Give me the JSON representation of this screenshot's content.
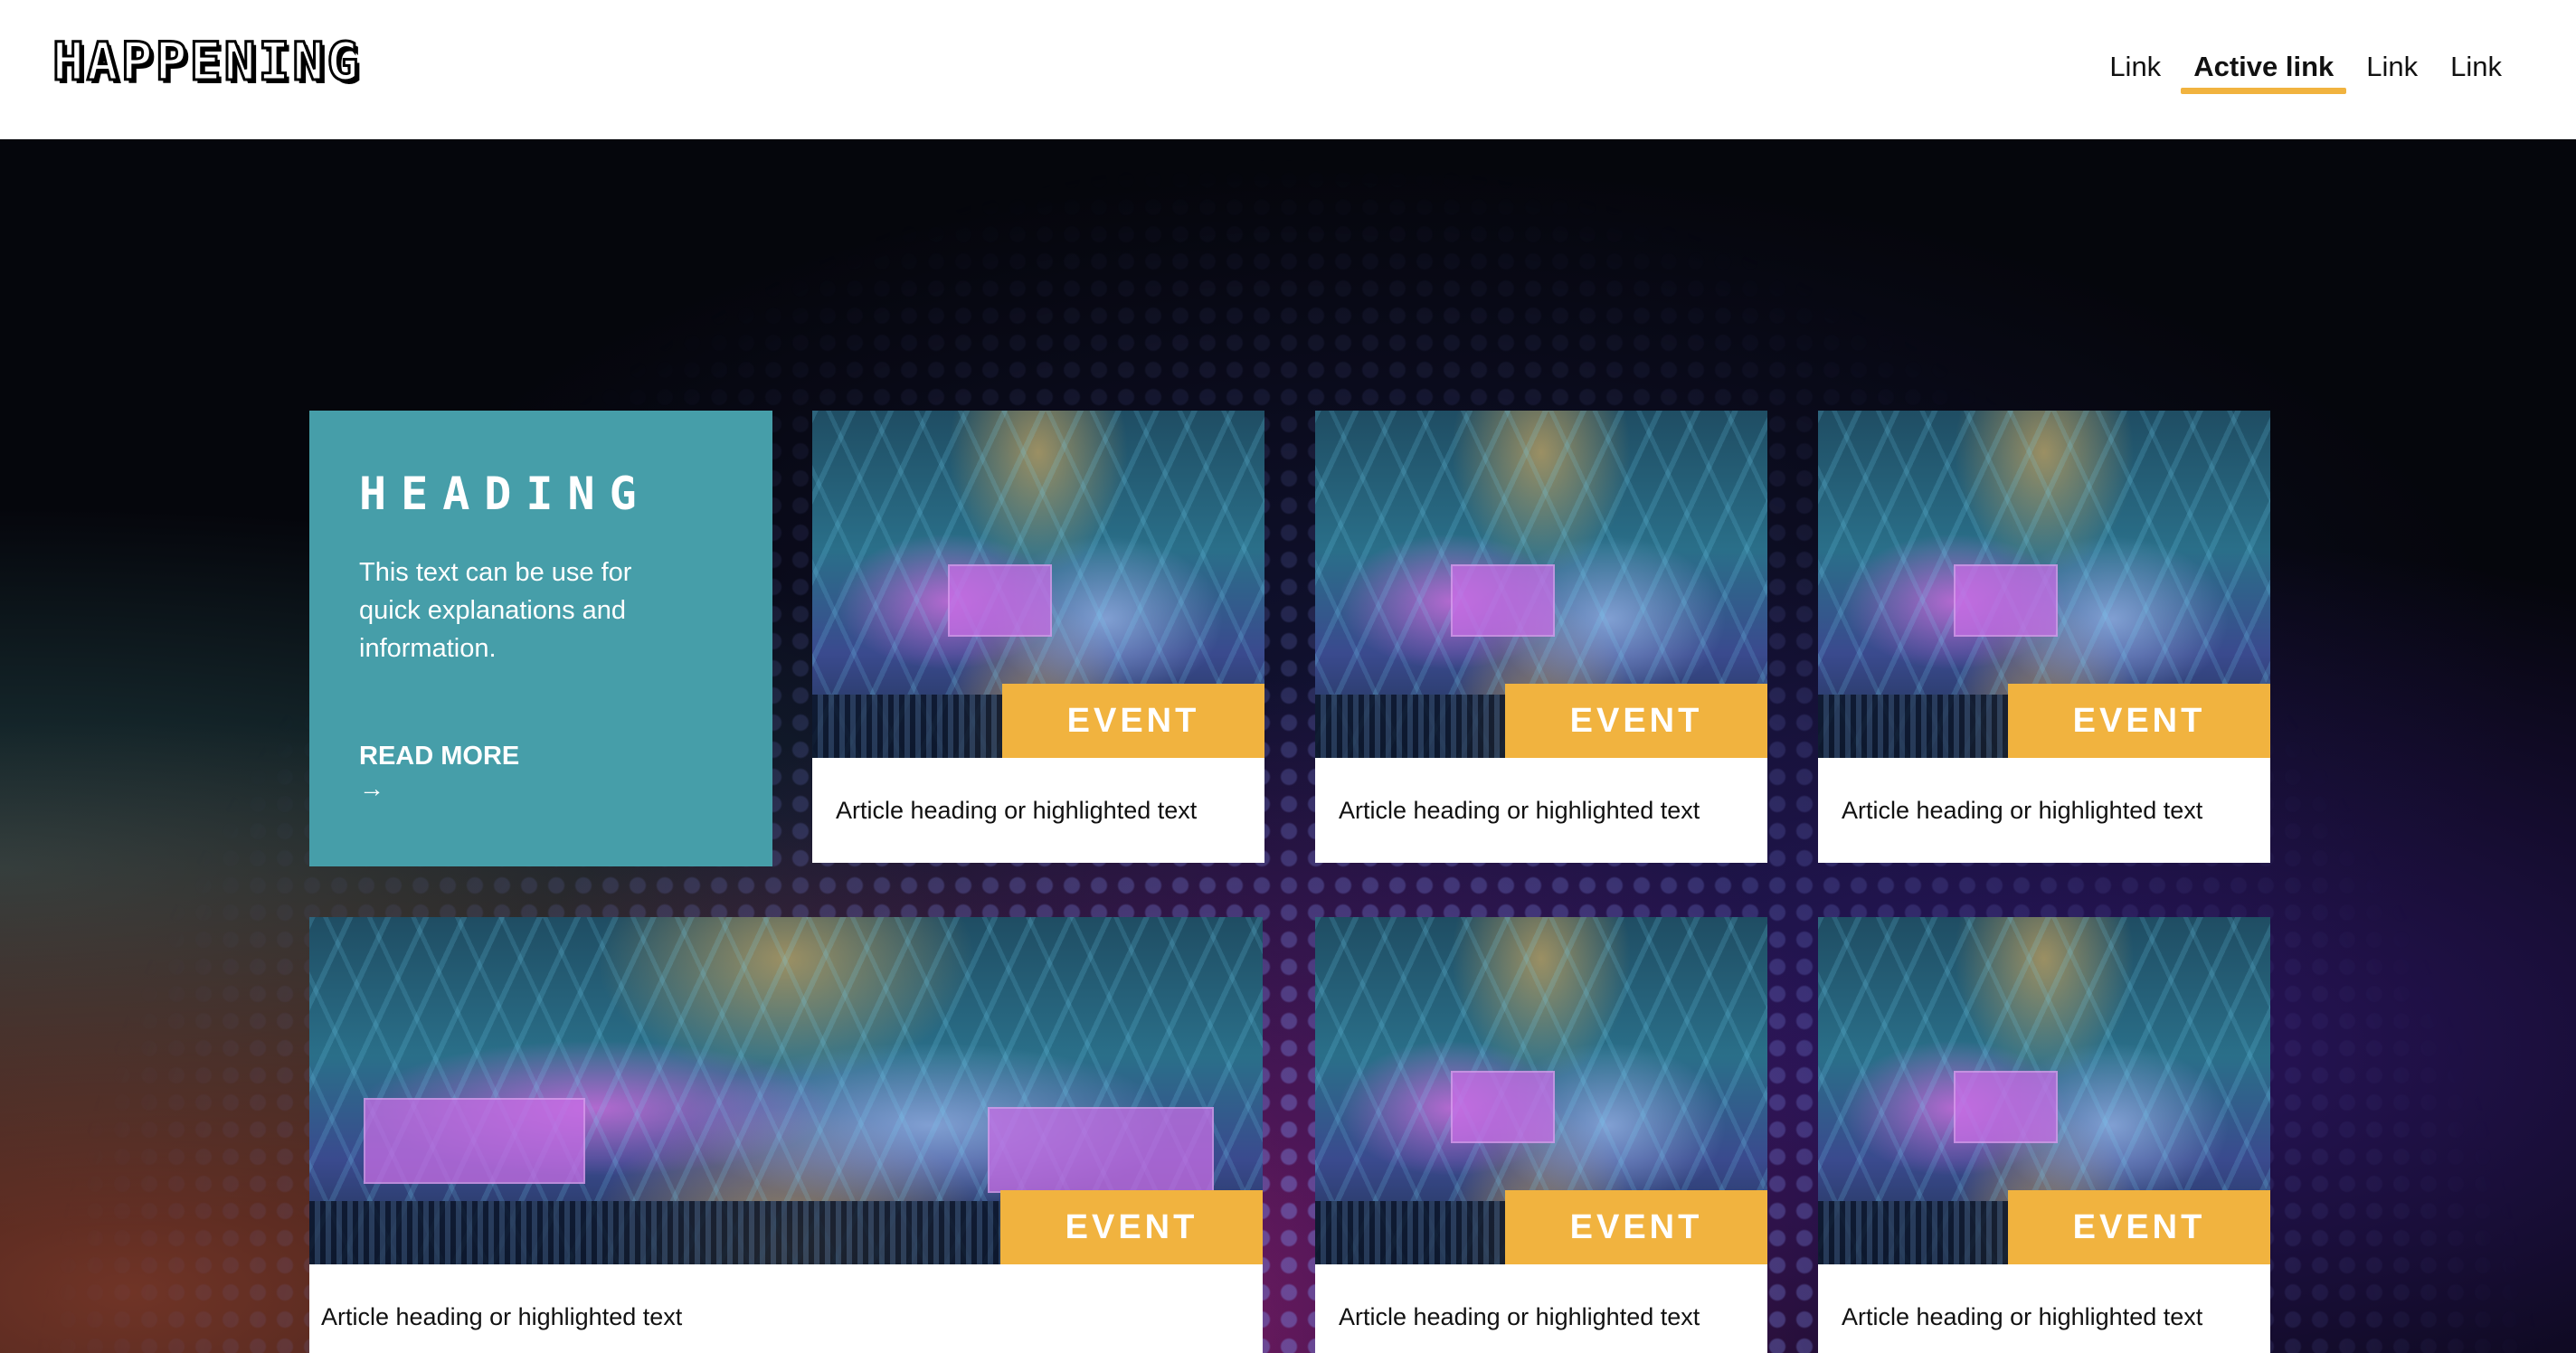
{
  "header": {
    "logo": "HAPPENING",
    "nav": [
      {
        "label": "Link",
        "active": false
      },
      {
        "label": "Active link",
        "active": true
      },
      {
        "label": "Link",
        "active": false
      },
      {
        "label": "Link",
        "active": false
      }
    ]
  },
  "info_card": {
    "heading": "HEADING",
    "text": "This text can be use for quick explanations and information.",
    "read_more": "READ MORE",
    "arrow": "→"
  },
  "cards": [
    {
      "tag": "EVENT",
      "text": "Article heading or highlighted text"
    },
    {
      "tag": "EVENT",
      "text": "Article heading or highlighted text"
    },
    {
      "tag": "EVENT",
      "text": "Article heading or highlighted text"
    },
    {
      "tag": "EVENT",
      "text": "Article heading or highlighted text"
    },
    {
      "tag": "EVENT",
      "text": "Article heading or highlighted text"
    },
    {
      "tag": "EVENT",
      "text": "Article heading or highlighted text"
    }
  ],
  "colors": {
    "accent": "#f1b33f",
    "info_card_bg": "#469ea9"
  }
}
